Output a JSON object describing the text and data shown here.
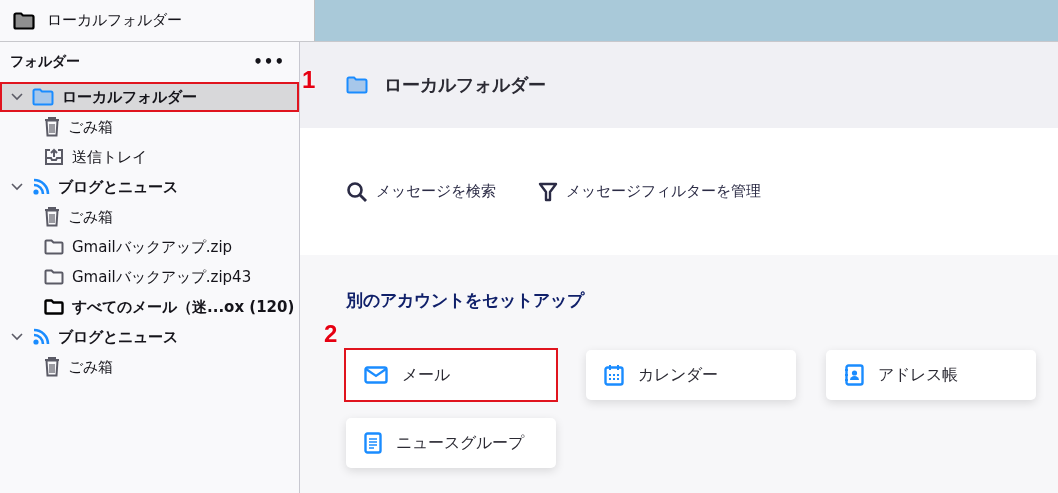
{
  "tab": {
    "title": "ローカルフォルダー",
    "selected": true
  },
  "sidebar": {
    "title": "フォルダー",
    "menu": "•••",
    "tree": [
      {
        "label": "ローカルフォルダー",
        "kind": "folder-blue",
        "selected": true,
        "expanded": true,
        "bold": true,
        "highlighted": true,
        "annotation": "1",
        "children": [
          {
            "label": "ごみ箱",
            "kind": "trash",
            "selected": false,
            "bold": false,
            "highlighted": false
          },
          {
            "label": "送信トレイ",
            "kind": "outbox",
            "selected": false,
            "bold": false,
            "highlighted": false
          }
        ]
      },
      {
        "label": "ブログとニュース",
        "kind": "rss",
        "selected": false,
        "expanded": true,
        "bold": true,
        "highlighted": false,
        "children": [
          {
            "label": "ごみ箱",
            "kind": "trash",
            "selected": false,
            "bold": false,
            "highlighted": false
          },
          {
            "label": "Gmailバックアップ.zip",
            "kind": "folder",
            "selected": false,
            "bold": false,
            "highlighted": false
          },
          {
            "label": "Gmailバックアップ.zip43",
            "kind": "folder",
            "selected": false,
            "bold": false,
            "highlighted": false
          },
          {
            "label": "すべてのメール（迷...ox (120)",
            "kind": "folder-dark",
            "selected": false,
            "bold": true,
            "highlighted": false
          }
        ]
      },
      {
        "label": "ブログとニュース",
        "kind": "rss",
        "selected": false,
        "expanded": true,
        "bold": true,
        "highlighted": false,
        "children": [
          {
            "label": "ごみ箱",
            "kind": "trash",
            "selected": false,
            "bold": false,
            "highlighted": false
          }
        ]
      }
    ]
  },
  "header": {
    "title": "ローカルフォルダー"
  },
  "actions": [
    {
      "label": "メッセージを検索",
      "kind": "search"
    },
    {
      "label": "メッセージフィルターを管理",
      "kind": "filter"
    }
  ],
  "setup": {
    "title": "別のアカウントをセットアップ",
    "cards": [
      {
        "label": "メール",
        "kind": "mail",
        "highlighted": true,
        "annotation": "2"
      },
      {
        "label": "カレンダー",
        "kind": "calendar",
        "highlighted": false
      },
      {
        "label": "アドレス帳",
        "kind": "addressbook",
        "highlighted": false
      },
      {
        "label": "ニュースグループ",
        "kind": "newsgroup",
        "highlighted": false
      }
    ]
  }
}
